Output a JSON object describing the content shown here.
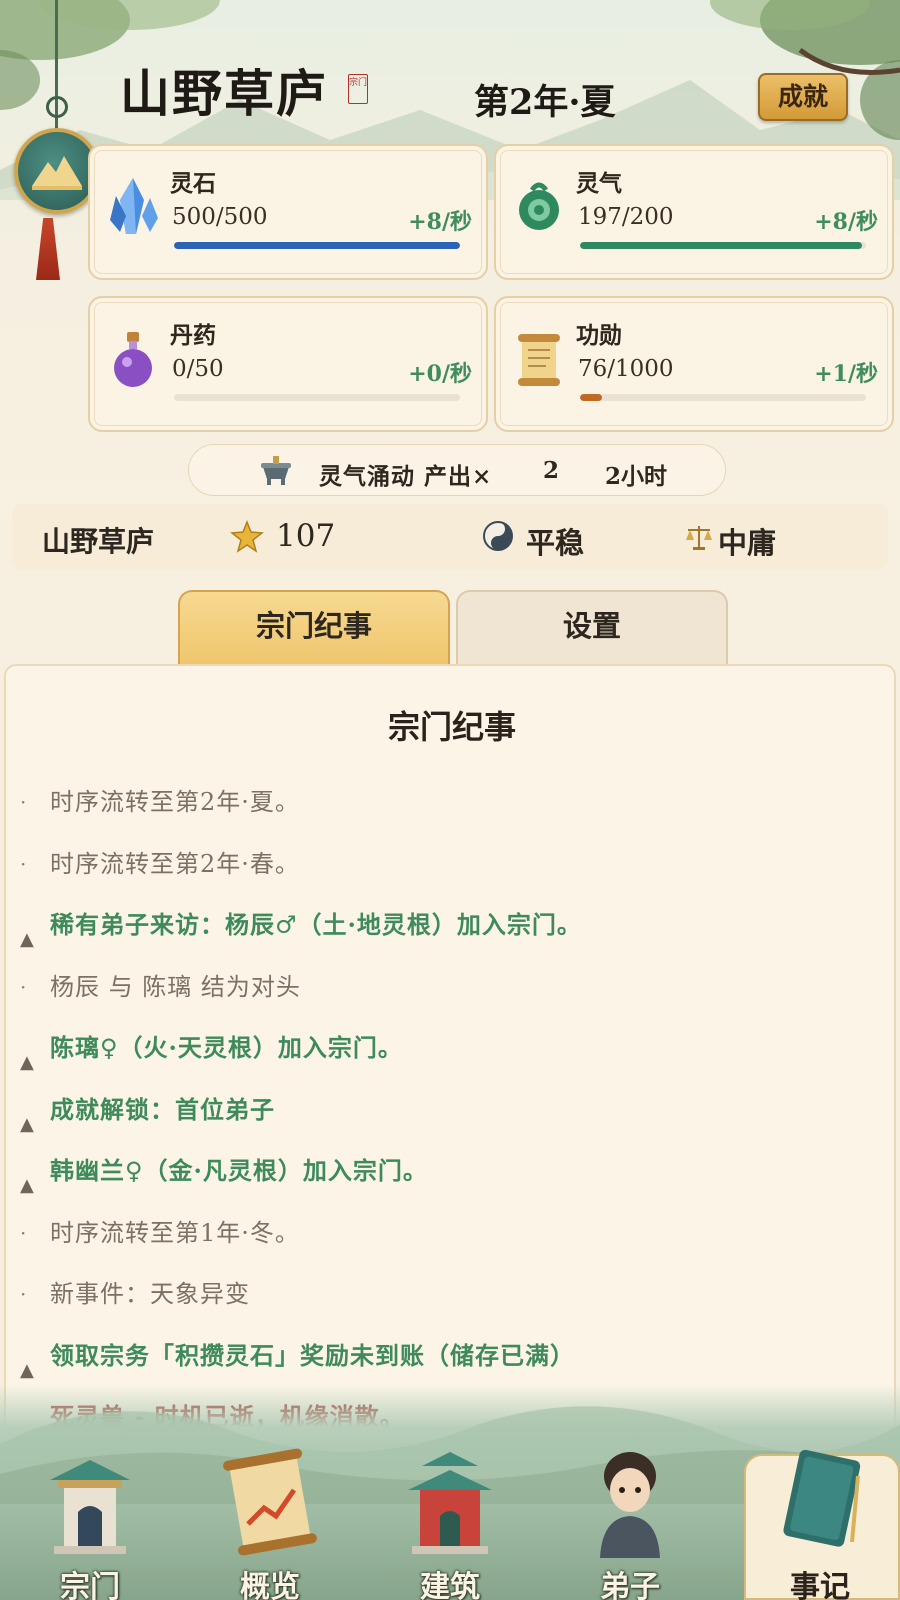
{
  "header": {
    "sect_name": "山野草庐",
    "seal_text": "宗门",
    "season": "第2年·夏",
    "achievements_button": "成就"
  },
  "resources": [
    {
      "key": "spirit-stone",
      "label": "灵石",
      "amount": "500/500",
      "rate": "+8/秒",
      "progress": 1.0,
      "bar_color": "#2c63b4",
      "icon": "crystal-icon"
    },
    {
      "key": "spirit-qi",
      "label": "灵气",
      "amount": "197/200",
      "rate": "+8/秒",
      "progress": 0.985,
      "bar_color": "#2f8a62",
      "icon": "jade-dragon-icon"
    },
    {
      "key": "elixir",
      "label": "丹药",
      "amount": "0/50",
      "rate": "+0/秒",
      "progress": 0.0,
      "bar_color": "#8a4fc2",
      "icon": "potion-icon"
    },
    {
      "key": "merit",
      "label": "功勋",
      "amount": "76/1000",
      "rate": "+1/秒",
      "progress": 0.076,
      "bar_color": "#c06a25",
      "icon": "scroll-icon"
    }
  ],
  "buff": {
    "icon": "incense-burner-icon",
    "text": "灵气涌动 产出×",
    "multiplier": "2",
    "duration": "2小时"
  },
  "status": {
    "sect_name": "山野草庐",
    "fame": "107",
    "stability": "平稳",
    "alignment": "中庸"
  },
  "tabs": [
    {
      "label": "宗门纪事",
      "active": true
    },
    {
      "label": "设置",
      "active": false
    }
  ],
  "chronicle": {
    "title": "宗门纪事",
    "entries": [
      {
        "marker": "·",
        "text": "时序流转至第2年·夏。",
        "tone": "grey"
      },
      {
        "marker": "·",
        "text": "时序流转至第2年·春。",
        "tone": "grey"
      },
      {
        "marker": "▲",
        "text": "稀有弟子来访：杨辰♂（土·地灵根）加入宗门。",
        "tone": "green"
      },
      {
        "marker": "·",
        "text": "杨辰 与 陈璃 结为对头",
        "tone": "grey"
      },
      {
        "marker": "▲",
        "text": "陈璃♀（火·天灵根）加入宗门。",
        "tone": "green"
      },
      {
        "marker": "▲",
        "text": "成就解锁：首位弟子",
        "tone": "green"
      },
      {
        "marker": "▲",
        "text": "韩幽兰♀（金·凡灵根）加入宗门。",
        "tone": "green"
      },
      {
        "marker": "·",
        "text": "时序流转至第1年·冬。",
        "tone": "grey"
      },
      {
        "marker": "·",
        "text": " 新事件：天象异变",
        "tone": "grey"
      },
      {
        "marker": "▲",
        "text": "领取宗务「积攒灵石」奖励未到账（储存已满）",
        "tone": "green"
      },
      {
        "marker": "",
        "text": "死灵兽 - 时机已逝，机缘消散。",
        "tone": "red"
      }
    ]
  },
  "nav": [
    {
      "label": "宗门",
      "icon": "sect-gate-icon",
      "active": false
    },
    {
      "label": "概览",
      "icon": "chart-scroll-icon",
      "active": false
    },
    {
      "label": "建筑",
      "icon": "pavilion-icon",
      "active": false
    },
    {
      "label": "弟子",
      "icon": "disciple-icon",
      "active": false
    },
    {
      "label": "事记",
      "icon": "book-icon",
      "active": true
    }
  ]
}
